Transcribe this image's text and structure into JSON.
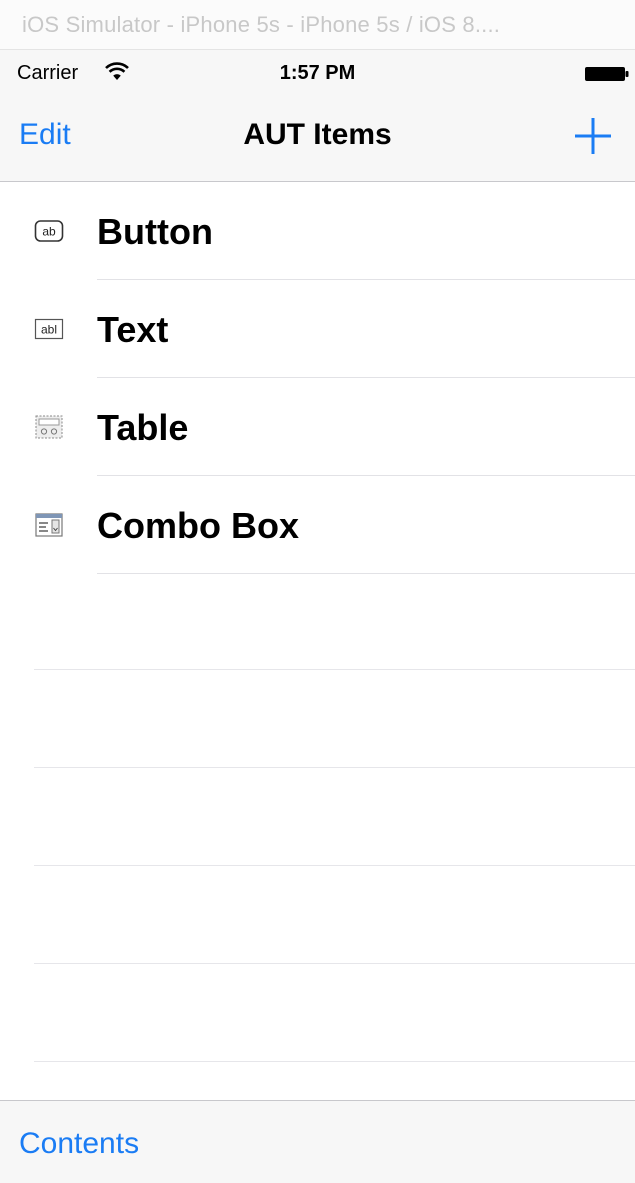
{
  "window": {
    "title": "iOS Simulator - iPhone 5s - iPhone 5s / iOS 8...."
  },
  "status_bar": {
    "carrier": "Carrier",
    "time": "1:57 PM",
    "icons": [
      "wifi-icon",
      "battery-icon"
    ]
  },
  "nav_bar": {
    "edit_label": "Edit",
    "title": "AUT Items",
    "add_icon": "plus-icon"
  },
  "items": [
    {
      "label": "Button",
      "icon": "button-control-icon"
    },
    {
      "label": "Text",
      "icon": "text-field-icon"
    },
    {
      "label": "Table",
      "icon": "table-icon"
    },
    {
      "label": "Combo Box",
      "icon": "combo-box-icon"
    }
  ],
  "toolbar": {
    "contents_label": "Contents"
  },
  "colors": {
    "accent": "#1a7cf4",
    "bar_background": "#f7f7f7",
    "separator": "#e2e2e6"
  }
}
